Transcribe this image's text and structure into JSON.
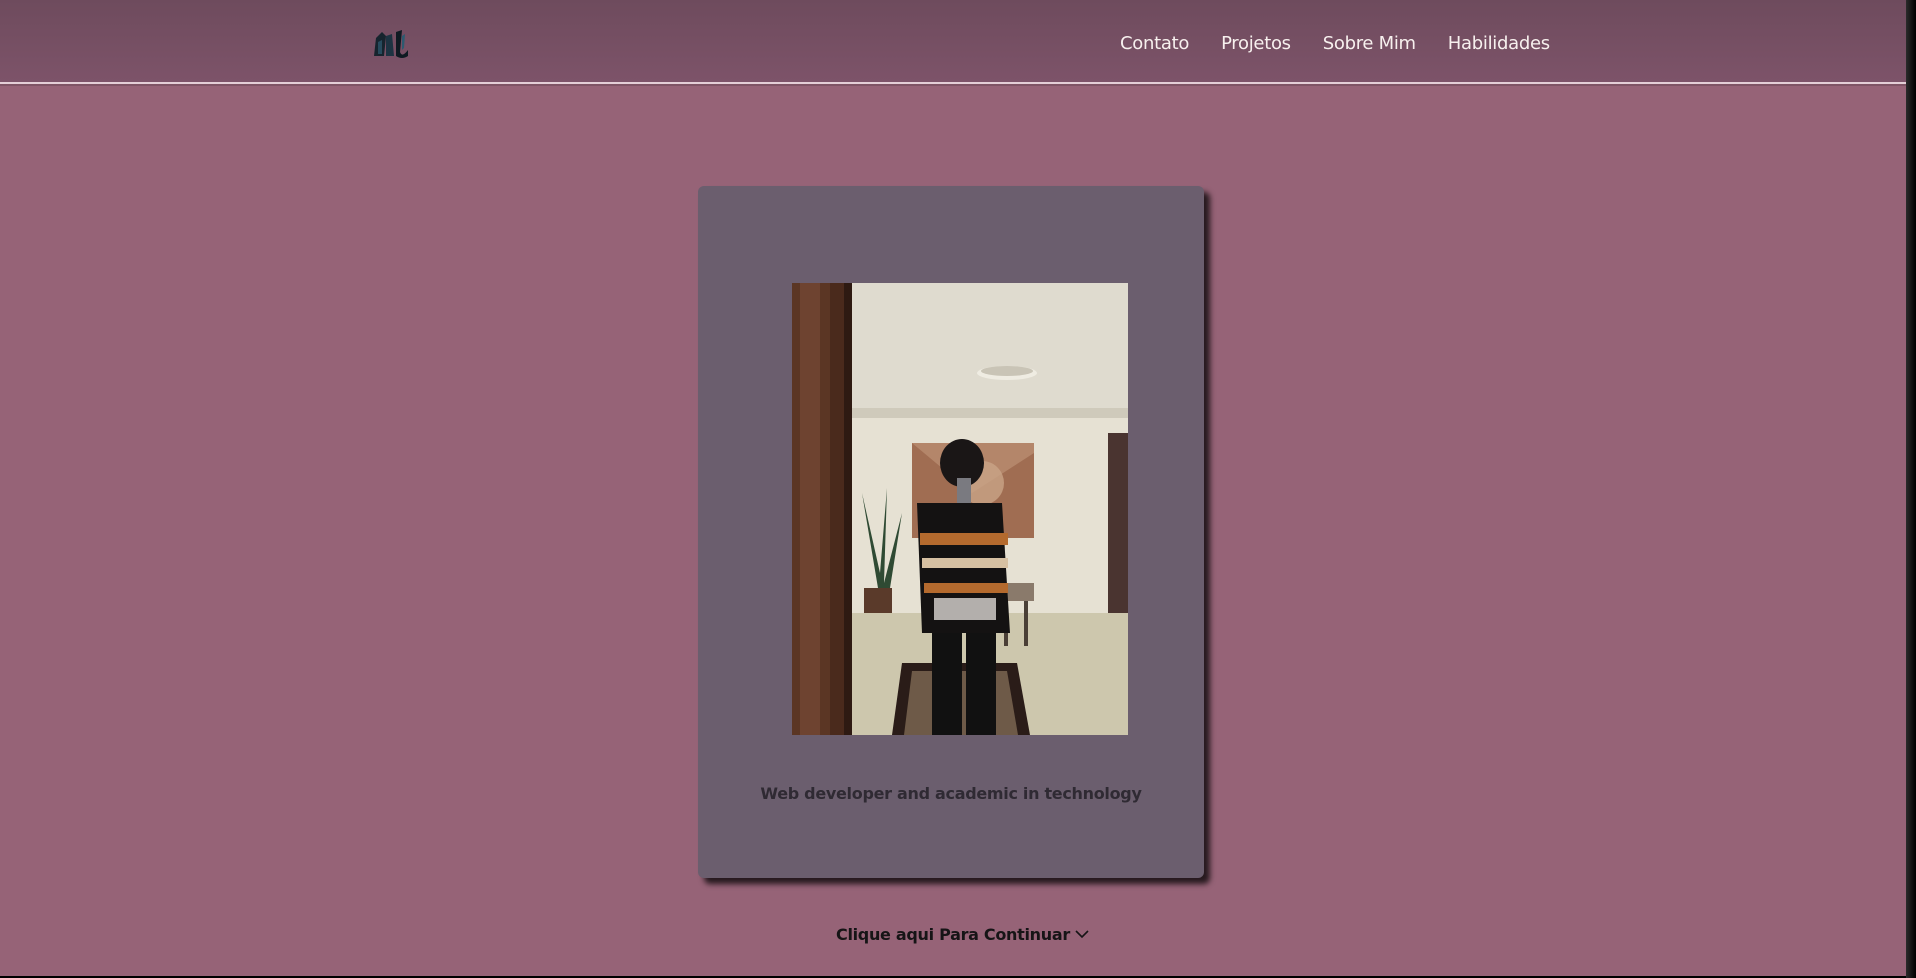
{
  "nav": {
    "logo_icon": "logo-icon",
    "links": [
      {
        "label": "Contato"
      },
      {
        "label": "Projetos"
      },
      {
        "label": "Sobre Mim"
      },
      {
        "label": "Habilidades"
      }
    ]
  },
  "hero": {
    "photo_icon": "profile-photo",
    "tagline": "Web developer and academic in technology"
  },
  "continue": {
    "label": "Clique aqui Para Continuar",
    "icon": "chevron-down-icon"
  },
  "colors": {
    "background": "#966377",
    "navbar": "#7a5166",
    "card": "#6b5e6e",
    "nav_text": "#f7f0ee"
  }
}
